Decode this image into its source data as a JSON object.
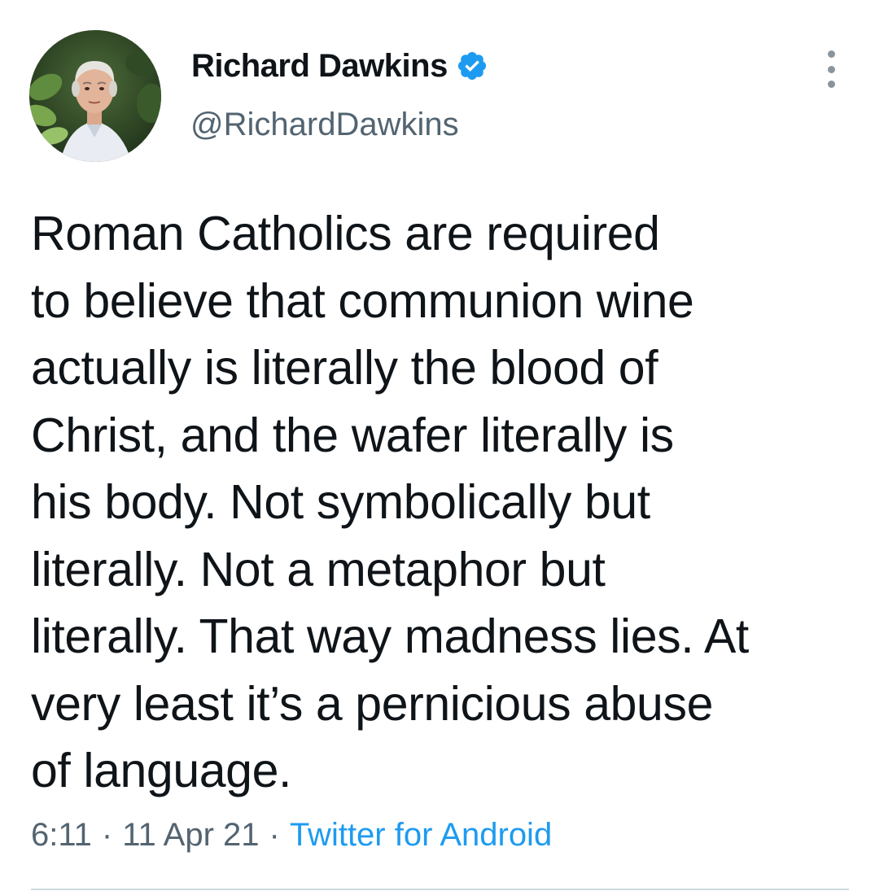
{
  "tweet": {
    "author": {
      "display_name": "Richard Dawkins",
      "handle": "@RichardDawkins",
      "verified": true,
      "avatar_icon": "profile-photo"
    },
    "text_lines": [
      "Roman Catholics are required",
      "to believe that communion wine",
      "actually is literally the blood of",
      "Christ, and the wafer literally is",
      "his body. Not symbolically but",
      "literally. Not a metaphor but",
      "literally. That way madness lies. At",
      "very least it’s a pernicious abuse",
      "of language."
    ],
    "time": "6:11",
    "date": "11 Apr 21",
    "separator": "·",
    "source": "Twitter for Android"
  },
  "colors": {
    "accent": "#1d9bf0",
    "text_primary": "#0f1419",
    "text_secondary": "#536471",
    "divider": "#cfd9de"
  }
}
